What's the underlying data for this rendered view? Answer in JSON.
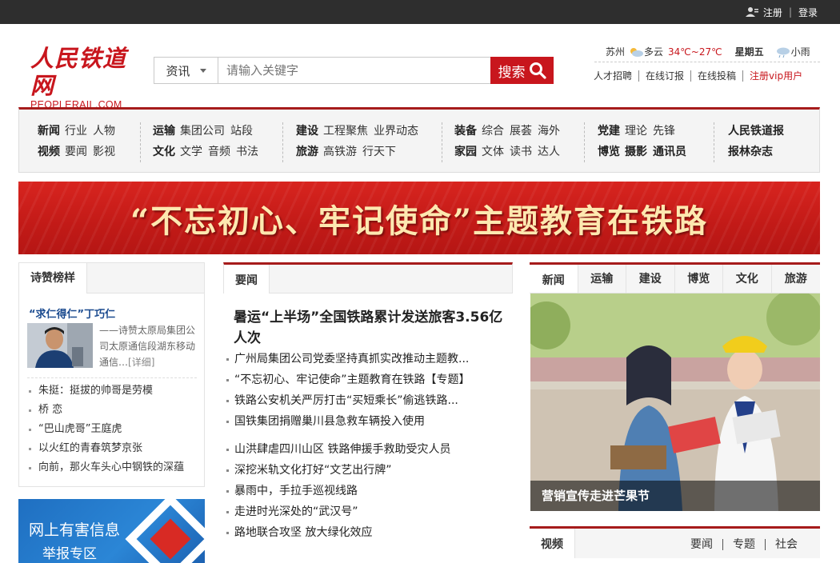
{
  "topbar": {
    "register": "注册",
    "login": "登录"
  },
  "logo": {
    "cn": "人民铁道网",
    "en": "PEOPLERAIL.COM"
  },
  "search": {
    "category": "资讯",
    "placeholder": "请输入关键字",
    "button": "搜索"
  },
  "weather": {
    "city": "苏州",
    "condition": "多云",
    "temp": "34℃~27℃",
    "day": "星期五",
    "next": "小雨"
  },
  "toplinks": [
    "人才招聘",
    "在线订报",
    "在线投稿",
    "注册vip用户"
  ],
  "nav": {
    "g1": {
      "r1b": "新闻",
      "r1": [
        "行业",
        "人物"
      ],
      "r2b": "视频",
      "r2": [
        "要闻",
        "影视"
      ]
    },
    "g2": {
      "r1b": "运输",
      "r1": [
        "集团公司",
        "站段"
      ],
      "r2b": "文化",
      "r2": [
        "文学",
        "音频",
        "书法"
      ]
    },
    "g3": {
      "r1b": "建设",
      "r1": [
        "工程聚焦",
        "业界动态"
      ],
      "r2b": "旅游",
      "r2": [
        "高铁游",
        "行天下"
      ]
    },
    "g4": {
      "r1b": "装备",
      "r1": [
        "综合",
        "展荟",
        "海外"
      ],
      "r2b": "家园",
      "r2": [
        "文体",
        "读书",
        "达人"
      ]
    },
    "g5": {
      "r1b": "党建",
      "r1": [
        "理论",
        "先锋"
      ],
      "r2b": "博览",
      "r2": [
        "摄影",
        "通讯员"
      ]
    },
    "g6": {
      "r1b": "人民铁道报",
      "r2b": "报林杂志"
    }
  },
  "banner": {
    "text": "“不忘初心、牢记使命”主题教育在铁路"
  },
  "left": {
    "tab": "诗赞榜样",
    "feature_title": "“求仁得仁”丁巧仁",
    "feature_desc": "——诗赞太原局集团公司太原通信段湖东移动通信…",
    "feature_more": "[详细]",
    "list": [
      "朱挺：挺拔的帅哥是劳模",
      "桥 恋",
      "“巴山虎哥”王庭虎",
      "以火红的青春筑梦京张",
      "向前，那火车头心中钢铁的深蕴"
    ]
  },
  "report": {
    "line1": "网上有害信息",
    "line2": "举报专区"
  },
  "middle": {
    "tab": "要闻",
    "headline": "暑运“上半场”全国铁路累计发送旅客3.56亿人次",
    "list1": [
      "广州局集团公司党委坚持真抓实改推动主题教...",
      "“不忘初心、牢记使命”主题教育在铁路【专题】",
      "铁路公安机关严厉打击“买短乘长”偷逃铁路...",
      "国铁集团捐赠巢川县急救车辆投入使用"
    ],
    "list2": [
      "山洪肆虐四川山区 铁路伸援手救助受灾人员",
      "深挖米轨文化打好“文艺出行牌”",
      "暴雨中，手拉手巡视线路",
      "走进时光深处的“武汉号”",
      "路地联合攻坚 放大绿化效应"
    ]
  },
  "right": {
    "tabs": [
      "新闻",
      "运输",
      "建设",
      "博览",
      "文化",
      "旅游"
    ],
    "caption": "营销宣传走进芒果节",
    "video_tab": "视频",
    "video_subs": [
      "要闻",
      "专题",
      "社会"
    ]
  },
  "colors": {
    "brand_red": "#c8161d",
    "dark_red": "#a61b1b",
    "topbar": "#2e2e2e"
  }
}
